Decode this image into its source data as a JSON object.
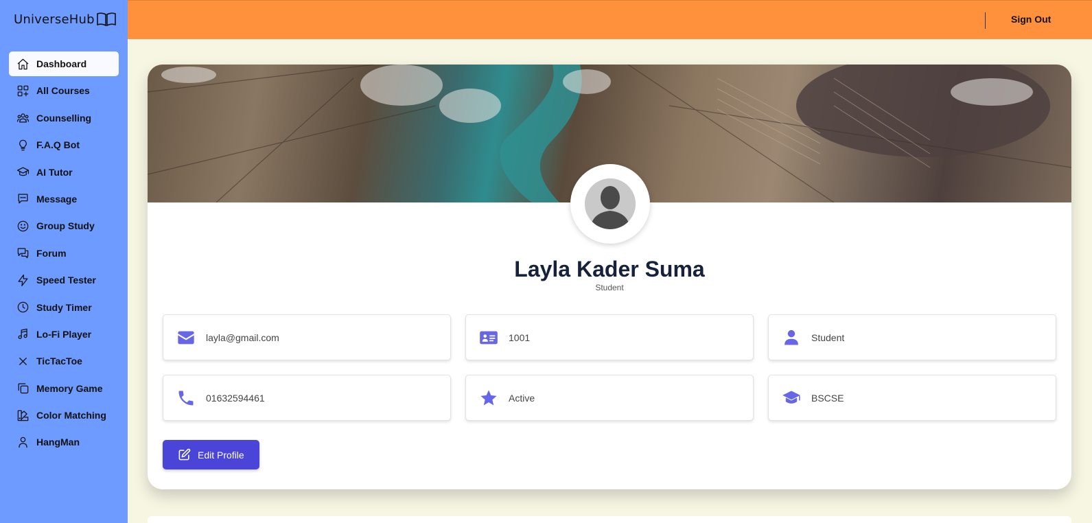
{
  "app": {
    "name": "UniverseHub"
  },
  "sidebar": {
    "items": [
      {
        "label": "Dashboard",
        "icon": "home-icon",
        "active": true
      },
      {
        "label": "All Courses",
        "icon": "grid-plus-icon"
      },
      {
        "label": "Counselling",
        "icon": "users-icon"
      },
      {
        "label": "F.A.Q Bot",
        "icon": "lightbulb-icon"
      },
      {
        "label": "AI Tutor",
        "icon": "graduation-cap-icon"
      },
      {
        "label": "Message",
        "icon": "chat-bubble-icon"
      },
      {
        "label": "Group Study",
        "icon": "smile-icon"
      },
      {
        "label": "Forum",
        "icon": "forum-icon"
      },
      {
        "label": "Speed Tester",
        "icon": "lightning-icon"
      },
      {
        "label": "Study Timer",
        "icon": "clock-icon"
      },
      {
        "label": "Lo-Fi Player",
        "icon": "music-note-icon"
      },
      {
        "label": "TicTacToe",
        "icon": "x-icon"
      },
      {
        "label": "Memory Game",
        "icon": "copy-icon"
      },
      {
        "label": "Color Matching",
        "icon": "palette-icon"
      },
      {
        "label": "HangMan",
        "icon": "person-icon"
      }
    ]
  },
  "topbar": {
    "sign_out_label": "Sign Out"
  },
  "profile": {
    "name": "Layla Kader Suma",
    "role": "Student",
    "fields": [
      {
        "icon": "envelope-icon",
        "value": "layla@gmail.com"
      },
      {
        "icon": "id-card-icon",
        "value": "1001"
      },
      {
        "icon": "user-icon",
        "value": "Student"
      },
      {
        "icon": "phone-icon",
        "value": "01632594461"
      },
      {
        "icon": "star-icon",
        "value": "Active"
      },
      {
        "icon": "graduation-cap-icon",
        "value": "BSCSE"
      }
    ],
    "edit_label": "Edit Profile"
  },
  "colors": {
    "sidebar_bg": "#6d9bff",
    "topbar_bg": "#ff913c",
    "page_bg": "#f7f6e3",
    "accent": "#4b44d9",
    "icon_color": "#6766e6"
  }
}
